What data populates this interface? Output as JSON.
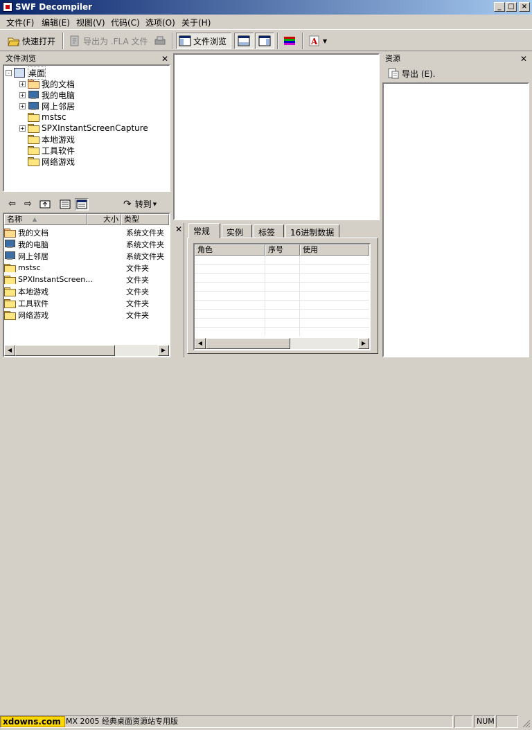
{
  "window": {
    "title": "SWF Decompiler"
  },
  "menu": [
    "文件(F)",
    "编辑(E)",
    "视图(V)",
    "代码(C)",
    "选项(O)",
    "关于(H)"
  ],
  "toolbar": {
    "quick_open": "快速打开",
    "export_fla": "导出为 .FLA 文件",
    "file_browse": "文件浏览"
  },
  "file_browser": {
    "title": "文件浏览",
    "tree": [
      {
        "label": "桌面",
        "icon": "desktop-icon",
        "expander": "-"
      },
      {
        "label": "我的文档",
        "icon": "my-documents-icon",
        "expander": "+"
      },
      {
        "label": "我的电脑",
        "icon": "my-computer-icon",
        "expander": "+"
      },
      {
        "label": "网上邻居",
        "icon": "network-icon",
        "expander": "+"
      },
      {
        "label": "mstsc",
        "icon": "folder-icon",
        "expander": ""
      },
      {
        "label": "SPXInstantScreenCapture",
        "icon": "folder-icon",
        "expander": "+"
      },
      {
        "label": "本地游戏",
        "icon": "folder-icon",
        "expander": ""
      },
      {
        "label": "工具软件",
        "icon": "folder-icon",
        "expander": ""
      },
      {
        "label": "网络游戏",
        "icon": "folder-icon",
        "expander": ""
      }
    ],
    "goto": "转到",
    "columns": [
      "名称",
      "大小",
      "类型"
    ],
    "files": [
      {
        "name": "我的文档",
        "type": "系统文件夹",
        "icon": "my-documents-icon"
      },
      {
        "name": "我的电脑",
        "type": "系统文件夹",
        "icon": "my-computer-icon"
      },
      {
        "name": "网上邻居",
        "type": "系统文件夹",
        "icon": "network-icon"
      },
      {
        "name": "mstsc",
        "type": "文件夹",
        "icon": "folder-icon"
      },
      {
        "name": "SPXInstantScreen...",
        "type": "文件夹",
        "icon": "folder-icon"
      },
      {
        "name": "本地游戏",
        "type": "文件夹",
        "icon": "folder-icon"
      },
      {
        "name": "工具软件",
        "type": "文件夹",
        "icon": "folder-icon"
      },
      {
        "name": "网络游戏",
        "type": "文件夹",
        "icon": "folder-icon"
      }
    ]
  },
  "properties": {
    "tabs": [
      "常规",
      "实例",
      "标签",
      "16进制数据"
    ],
    "active_tab": "常规",
    "columns": [
      "角色",
      "序号",
      "使用"
    ]
  },
  "resources": {
    "title": "资源",
    "export": "导出 (E)."
  },
  "statusbar": {
    "brand": "xdowns.com",
    "message": "MX 2005 经典桌面资源站专用版",
    "num": "NUM"
  },
  "colors": {
    "title_start": "#0a246a",
    "title_end": "#a6caf0",
    "face": "#d4d0c8",
    "brand_bg": "#ffd800"
  }
}
